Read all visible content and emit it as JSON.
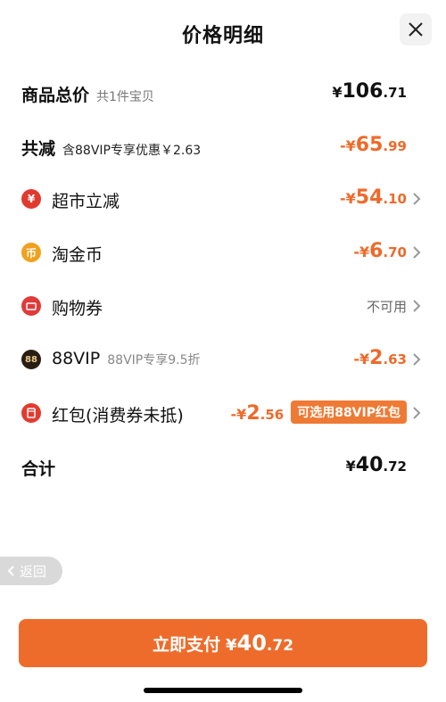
{
  "header": {
    "title": "价格明细",
    "close_icon": "close-icon"
  },
  "total_price": {
    "label": "商品总价",
    "sub": "共1件宝贝",
    "yen": "¥",
    "int": "106",
    "dec": ".71"
  },
  "discount_total": {
    "label": "共减",
    "sub": "含88VIP专享优惠￥2.63",
    "prefix": "-¥",
    "int": "65",
    "dec": ".99"
  },
  "items": [
    {
      "label": "超市立减",
      "sub": "",
      "prefix": "-¥",
      "int": "54",
      "dec": ".10",
      "icon": "supermarket-discount-icon",
      "icon_text": "¥",
      "icon_color": "#e03a2f"
    },
    {
      "label": "淘金币",
      "sub": "",
      "prefix": "-¥",
      "int": "6",
      "dec": ".70",
      "icon": "taojinbi-coin-icon",
      "icon_text": "币",
      "icon_color": "#f0a11e"
    },
    {
      "label": "购物券",
      "sub": "",
      "status": "不可用",
      "icon": "coupon-icon",
      "icon_color": "#e03a3a"
    },
    {
      "label": "88VIP",
      "sub": "88VIP专享9.5折",
      "prefix": "-¥",
      "int": "2",
      "dec": ".63",
      "icon": "vip88-icon",
      "icon_text": "88",
      "icon_color": "#2a1e14"
    },
    {
      "label": "红包(消费券未抵)",
      "sub": "",
      "prefix": "-¥",
      "int": "2",
      "dec": ".56",
      "badge": "可选用88VIP红包",
      "icon": "red-packet-icon",
      "icon_color": "#e23b2e"
    }
  ],
  "sum": {
    "label": "合计",
    "yen": "¥",
    "int": "40",
    "dec": ".72"
  },
  "back": {
    "label": "返回"
  },
  "pay_button": {
    "label": "立即支付",
    "yen": "¥",
    "int": "40",
    "dec": ".72"
  },
  "colors": {
    "accent": "#ee6c2b",
    "discount_text": "#ee6a2a"
  }
}
